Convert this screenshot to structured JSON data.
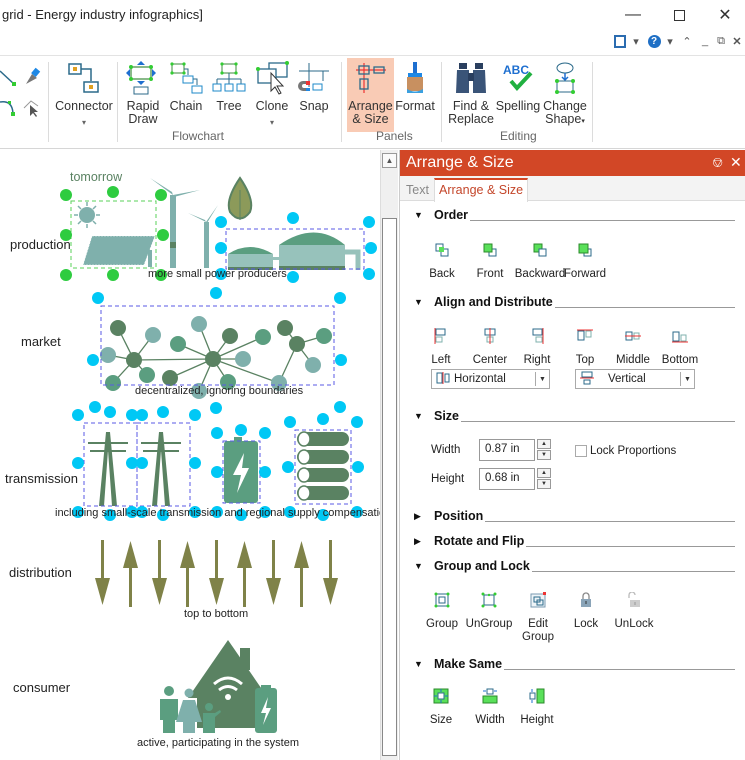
{
  "window": {
    "title": "grid - Energy industry infographics]",
    "controls": [
      "minimize",
      "maximize",
      "close"
    ]
  },
  "ribbon": {
    "groups": [
      {
        "label": "",
        "buttons": [
          {
            "icon": "line-tool-icon"
          },
          {
            "icon": "pen-tool-icon"
          },
          {
            "icon": "curve-tool-icon"
          },
          {
            "icon": "edit-point-icon"
          }
        ]
      },
      {
        "label": "",
        "buttons": [
          {
            "label": "Connector",
            "icon": "connector-icon",
            "dropdown": true
          }
        ]
      },
      {
        "label": "Flowchart",
        "buttons": [
          {
            "label": "Rapid Draw",
            "icon": "rapid-draw-icon"
          },
          {
            "label": "Chain",
            "icon": "chain-icon"
          },
          {
            "label": "Tree",
            "icon": "tree-icon"
          },
          {
            "label": "Clone",
            "icon": "clone-icon",
            "dropdown": true
          },
          {
            "label": "Snap",
            "icon": "snap-icon"
          }
        ]
      },
      {
        "label": "Panels",
        "buttons": [
          {
            "label": "Arrange & Size",
            "icon": "arrange-size-icon",
            "active": true
          },
          {
            "label": "Format",
            "icon": "format-brush-icon"
          }
        ]
      },
      {
        "label": "Editing",
        "buttons": [
          {
            "label": "Find & Replace",
            "icon": "binoculars-icon"
          },
          {
            "label": "Spelling",
            "icon": "spelling-icon"
          },
          {
            "label": "Change Shape",
            "icon": "change-shape-icon",
            "dropdown": true
          }
        ]
      }
    ]
  },
  "canvas": {
    "rows": [
      {
        "label": "production",
        "caption": "more small power producers"
      },
      {
        "label": "market",
        "caption": "decentralized, ignoring boundaries"
      },
      {
        "label": "transmission",
        "caption": "including small-scale transmission and regional supply compensation"
      },
      {
        "label": "distribution",
        "caption": "top to bottom"
      },
      {
        "label": "consumer",
        "caption": "active, participating in the system"
      }
    ],
    "header_text": "tomorrow",
    "colors": {
      "dark_green": "#5a8262",
      "mid_green": "#5b9e80",
      "teal": "#7fb0ac",
      "olive": "#7f8248",
      "handle_cyan": "#00c8f5",
      "handle_green": "#2ecc40",
      "selection_dash": "#5a5ae6"
    }
  },
  "panel": {
    "title": "Arrange & Size",
    "accent": "#d24726",
    "tabs": [
      {
        "label": "Text",
        "active": false
      },
      {
        "label": "Arrange & Size",
        "active": true
      }
    ],
    "sections": {
      "order": {
        "label": "Order",
        "expanded": true,
        "buttons": [
          "Back",
          "Front",
          "Backward",
          "Forward"
        ]
      },
      "align": {
        "label": "Align and Distribute",
        "expanded": true,
        "buttons": [
          "Left",
          "Center",
          "Right",
          "Top",
          "Middle",
          "Bottom"
        ],
        "horizontal_select": "Horizontal",
        "vertical_select": "Vertical"
      },
      "size": {
        "label": "Size",
        "expanded": true,
        "width_label": "Width",
        "width_value": "0.87 in",
        "height_label": "Height",
        "height_value": "0.68 in",
        "lock_label": "Lock Proportions",
        "lock_checked": false
      },
      "position": {
        "label": "Position",
        "expanded": false
      },
      "rotate": {
        "label": "Rotate and Flip",
        "expanded": false
      },
      "group": {
        "label": "Group and Lock",
        "expanded": true,
        "buttons": [
          "Group",
          "UnGroup",
          "Edit Group",
          "Lock",
          "UnLock"
        ]
      },
      "same": {
        "label": "Make Same",
        "expanded": true,
        "buttons": [
          "Size",
          "Width",
          "Height"
        ]
      }
    }
  }
}
